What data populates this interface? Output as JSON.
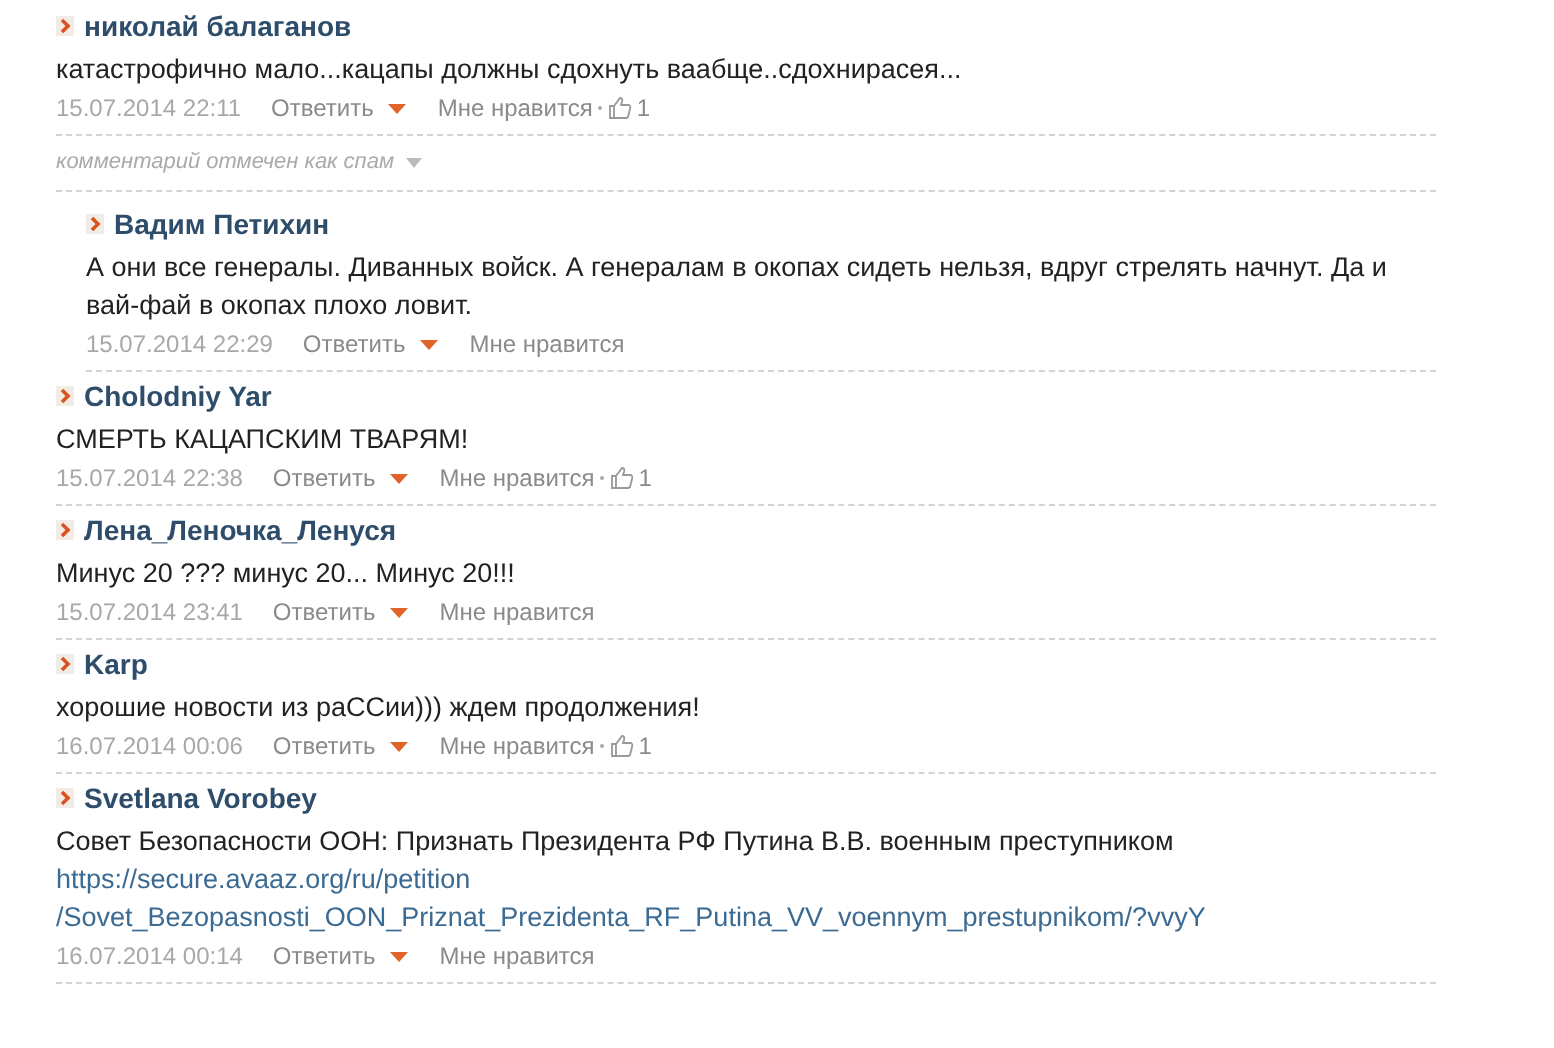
{
  "comments": [
    {
      "kind": "comment",
      "author": "николай балаганов",
      "text": "катастрофично мало...кацапы должны сдохнуть ваабще..сдохнирасея...",
      "date": "15.07.2014 22:11",
      "reply": "Ответить",
      "like": "Мне нравится",
      "likes": "1"
    },
    {
      "kind": "spam",
      "notice": "комментарий отмечен как спам",
      "children": [
        {
          "kind": "comment",
          "author": "Вадим Петихин",
          "text": "А они все генералы. Диванных войск. А генералам в окопах сидеть нельзя, вдруг стрелять начнут. Да и вай-фай в окопах плохо ловит.",
          "date": "15.07.2014 22:29",
          "reply": "Ответить",
          "like": "Мне нравится"
        }
      ]
    },
    {
      "kind": "comment",
      "author": "Cholodniy Yar",
      "text": "СМЕРТЬ КАЦАПСКИМ ТВАРЯМ!",
      "date": "15.07.2014 22:38",
      "reply": "Ответить",
      "like": "Мне нравится",
      "likes": "1"
    },
    {
      "kind": "comment",
      "author": "Лена_Леночка_Ленуся",
      "text": "Минус 20 ??? минус 20... Минус 20!!!",
      "date": "15.07.2014 23:41",
      "reply": "Ответить",
      "like": "Мне нравится"
    },
    {
      "kind": "comment",
      "author": "Karp",
      "text": "хорошие новости из раССии))) ждем продолжения!",
      "date": "16.07.2014 00:06",
      "reply": "Ответить",
      "like": "Мне нравится",
      "likes": "1"
    },
    {
      "kind": "comment",
      "author": "Svetlana Vorobey",
      "text": "Совет Безопасности ООН: Признать Президента РФ Путина В.В. военным преступником",
      "link_lines": [
        "https://secure.avaaz.org/ru/petition",
        "/Sovet_Bezopasnosti_OON_Priznat_Prezidenta_RF_Putina_VV_voennym_prestupnikom/?vvyY"
      ],
      "date": "16.07.2014 00:14",
      "reply": "Ответить",
      "like": "Мне нравится"
    }
  ]
}
